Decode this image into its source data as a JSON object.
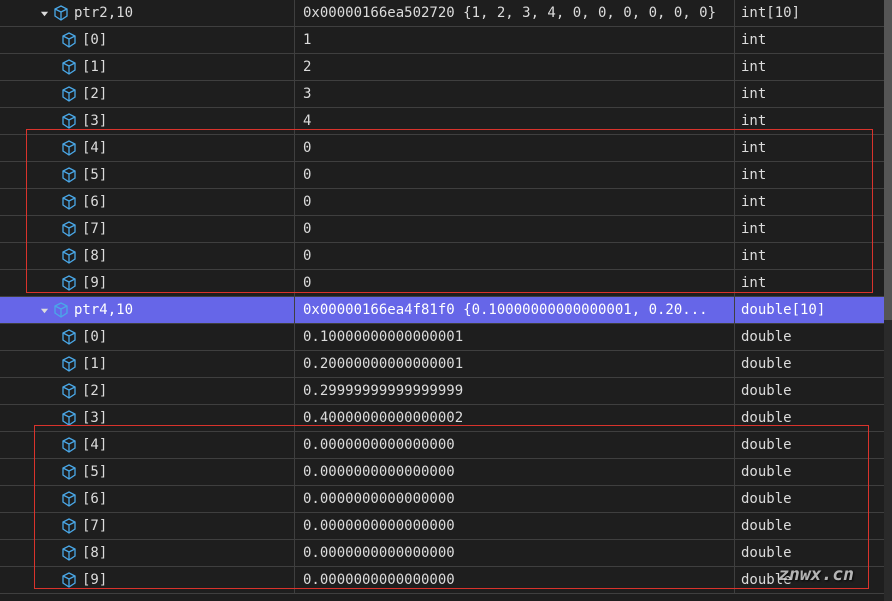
{
  "watermark": "znwx.cn",
  "rows": [
    {
      "indent": 1,
      "expanded": true,
      "name": "ptr2,10",
      "value": "0x00000166ea502720 {1, 2, 3, 4, 0, 0, 0, 0, 0, 0}",
      "type": "int[10]",
      "selected": false
    },
    {
      "indent": 2,
      "expanded": null,
      "name": "[0]",
      "value": "1",
      "type": "int",
      "selected": false
    },
    {
      "indent": 2,
      "expanded": null,
      "name": "[1]",
      "value": "2",
      "type": "int",
      "selected": false
    },
    {
      "indent": 2,
      "expanded": null,
      "name": "[2]",
      "value": "3",
      "type": "int",
      "selected": false
    },
    {
      "indent": 2,
      "expanded": null,
      "name": "[3]",
      "value": "4",
      "type": "int",
      "selected": false
    },
    {
      "indent": 2,
      "expanded": null,
      "name": "[4]",
      "value": "0",
      "type": "int",
      "selected": false
    },
    {
      "indent": 2,
      "expanded": null,
      "name": "[5]",
      "value": "0",
      "type": "int",
      "selected": false
    },
    {
      "indent": 2,
      "expanded": null,
      "name": "[6]",
      "value": "0",
      "type": "int",
      "selected": false
    },
    {
      "indent": 2,
      "expanded": null,
      "name": "[7]",
      "value": "0",
      "type": "int",
      "selected": false
    },
    {
      "indent": 2,
      "expanded": null,
      "name": "[8]",
      "value": "0",
      "type": "int",
      "selected": false
    },
    {
      "indent": 2,
      "expanded": null,
      "name": "[9]",
      "value": "0",
      "type": "int",
      "selected": false
    },
    {
      "indent": 1,
      "expanded": true,
      "name": "ptr4,10",
      "value": "0x00000166ea4f81f0 {0.10000000000000001, 0.20...",
      "type": "double[10]",
      "selected": true
    },
    {
      "indent": 2,
      "expanded": null,
      "name": "[0]",
      "value": "0.10000000000000001",
      "type": "double",
      "selected": false
    },
    {
      "indent": 2,
      "expanded": null,
      "name": "[1]",
      "value": "0.20000000000000001",
      "type": "double",
      "selected": false
    },
    {
      "indent": 2,
      "expanded": null,
      "name": "[2]",
      "value": "0.29999999999999999",
      "type": "double",
      "selected": false
    },
    {
      "indent": 2,
      "expanded": null,
      "name": "[3]",
      "value": "0.40000000000000002",
      "type": "double",
      "selected": false
    },
    {
      "indent": 2,
      "expanded": null,
      "name": "[4]",
      "value": "0.0000000000000000",
      "type": "double",
      "selected": false
    },
    {
      "indent": 2,
      "expanded": null,
      "name": "[5]",
      "value": "0.0000000000000000",
      "type": "double",
      "selected": false
    },
    {
      "indent": 2,
      "expanded": null,
      "name": "[6]",
      "value": "0.0000000000000000",
      "type": "double",
      "selected": false
    },
    {
      "indent": 2,
      "expanded": null,
      "name": "[7]",
      "value": "0.0000000000000000",
      "type": "double",
      "selected": false
    },
    {
      "indent": 2,
      "expanded": null,
      "name": "[8]",
      "value": "0.0000000000000000",
      "type": "double",
      "selected": false
    },
    {
      "indent": 2,
      "expanded": null,
      "name": "[9]",
      "value": "0.0000000000000000",
      "type": "double",
      "selected": false
    }
  ]
}
